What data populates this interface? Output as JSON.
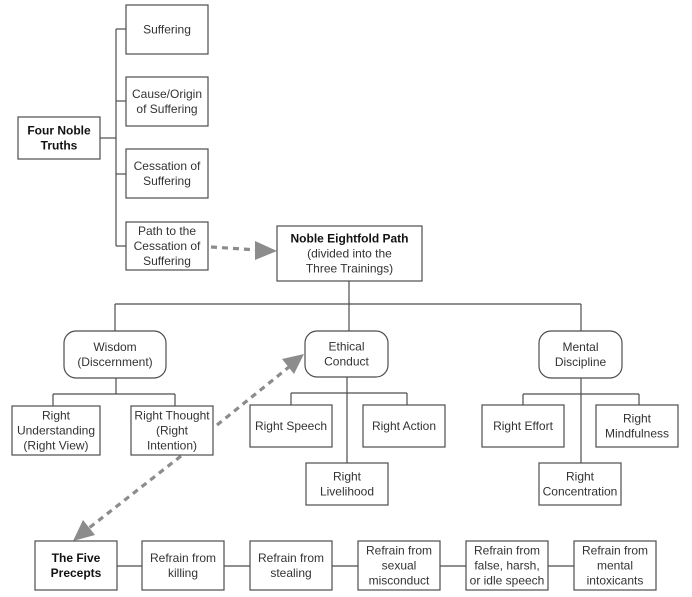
{
  "four_noble_truths": {
    "root": {
      "lines": [
        "Four Noble",
        "Truths"
      ]
    },
    "items": [
      {
        "id": "suffering",
        "lines": [
          "Suffering"
        ]
      },
      {
        "id": "cause",
        "lines": [
          "Cause/Origin",
          "of Suffering"
        ]
      },
      {
        "id": "cessation",
        "lines": [
          "Cessation of",
          "Suffering"
        ]
      },
      {
        "id": "path",
        "lines": [
          "Path to the",
          "Cessation of",
          "Suffering"
        ]
      }
    ]
  },
  "eightfold_path": {
    "root": {
      "lines": [
        "Noble Eightfold Path",
        "(divided into the",
        "Three Trainings)"
      ]
    },
    "trainings": [
      {
        "id": "wisdom",
        "lines": [
          "Wisdom",
          "(Discernment)"
        ],
        "children": [
          {
            "id": "right-understanding",
            "lines": [
              "Right",
              "Understanding",
              "(Right View)"
            ]
          },
          {
            "id": "right-thought",
            "lines": [
              "Right Thought",
              "(Right",
              "Intention)"
            ]
          }
        ]
      },
      {
        "id": "ethical",
        "lines": [
          "Ethical",
          "Conduct"
        ],
        "children": [
          {
            "id": "right-speech",
            "lines": [
              "Right Speech"
            ]
          },
          {
            "id": "right-action",
            "lines": [
              "Right Action"
            ]
          },
          {
            "id": "right-livelihood",
            "lines": [
              "Right",
              "Livelihood"
            ]
          }
        ]
      },
      {
        "id": "mental",
        "lines": [
          "Mental",
          "Discipline"
        ],
        "children": [
          {
            "id": "right-effort",
            "lines": [
              "Right Effort"
            ]
          },
          {
            "id": "right-mindfulness",
            "lines": [
              "Right",
              "Mindfulness"
            ]
          },
          {
            "id": "right-concentration",
            "lines": [
              "Right",
              "Concentration"
            ]
          }
        ]
      }
    ]
  },
  "five_precepts": {
    "root": {
      "lines": [
        "The Five",
        "Precepts"
      ]
    },
    "items": [
      {
        "id": "killing",
        "lines": [
          "Refrain from",
          "killing"
        ]
      },
      {
        "id": "stealing",
        "lines": [
          "Refrain from",
          "stealing"
        ]
      },
      {
        "id": "sexual",
        "lines": [
          "Refrain from",
          "sexual",
          "misconduct"
        ]
      },
      {
        "id": "speech",
        "lines": [
          "Refrain from",
          "false, harsh,",
          "or idle speech"
        ]
      },
      {
        "id": "intoxicants",
        "lines": [
          "Refrain from",
          "mental",
          "intoxicants"
        ]
      }
    ]
  },
  "colors": {
    "line": "#4d4d4d",
    "dashed_arrow": "#8c8c8c",
    "text": "#333333"
  }
}
